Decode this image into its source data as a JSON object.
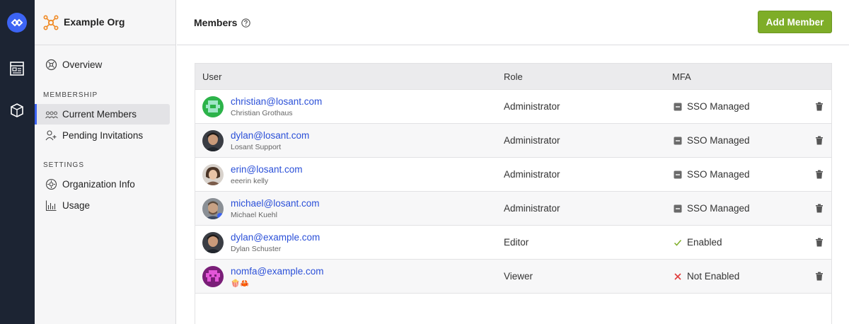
{
  "sidebar": {
    "org_name": "Example Org",
    "overview_label": "Overview",
    "membership_heading": "MEMBERSHIP",
    "current_members_label": "Current Members",
    "pending_invitations_label": "Pending Invitations",
    "settings_heading": "SETTINGS",
    "organization_info_label": "Organization Info",
    "usage_label": "Usage"
  },
  "header": {
    "title": "Members",
    "add_member_label": "Add Member"
  },
  "table": {
    "columns": {
      "user": "User",
      "role": "Role",
      "mfa": "MFA"
    },
    "rows": [
      {
        "email": "christian@losant.com",
        "name": "Christian Grothaus",
        "role": "Administrator",
        "mfa": "SSO Managed",
        "mfa_icon": "minus-square-icon"
      },
      {
        "email": "dylan@losant.com",
        "name": "Losant Support",
        "role": "Administrator",
        "mfa": "SSO Managed",
        "mfa_icon": "minus-square-icon"
      },
      {
        "email": "erin@losant.com",
        "name": "eeerin kelly",
        "role": "Administrator",
        "mfa": "SSO Managed",
        "mfa_icon": "minus-square-icon"
      },
      {
        "email": "michael@losant.com",
        "name": "Michael Kuehl",
        "role": "Administrator",
        "mfa": "SSO Managed",
        "mfa_icon": "minus-square-icon"
      },
      {
        "email": "dylan@example.com",
        "name": "Dylan Schuster",
        "role": "Editor",
        "mfa": "Enabled",
        "mfa_icon": "check-icon"
      },
      {
        "email": "nomfa@example.com",
        "name": "🍿🦀",
        "role": "Viewer",
        "mfa": "Not Enabled",
        "mfa_icon": "x-icon"
      }
    ]
  },
  "colors": {
    "accent": "#3c64f4",
    "add_button": "#7ead28",
    "link": "#2b50d8",
    "rail": "#1c2433",
    "check": "#7ead28",
    "x": "#e03b3b"
  }
}
